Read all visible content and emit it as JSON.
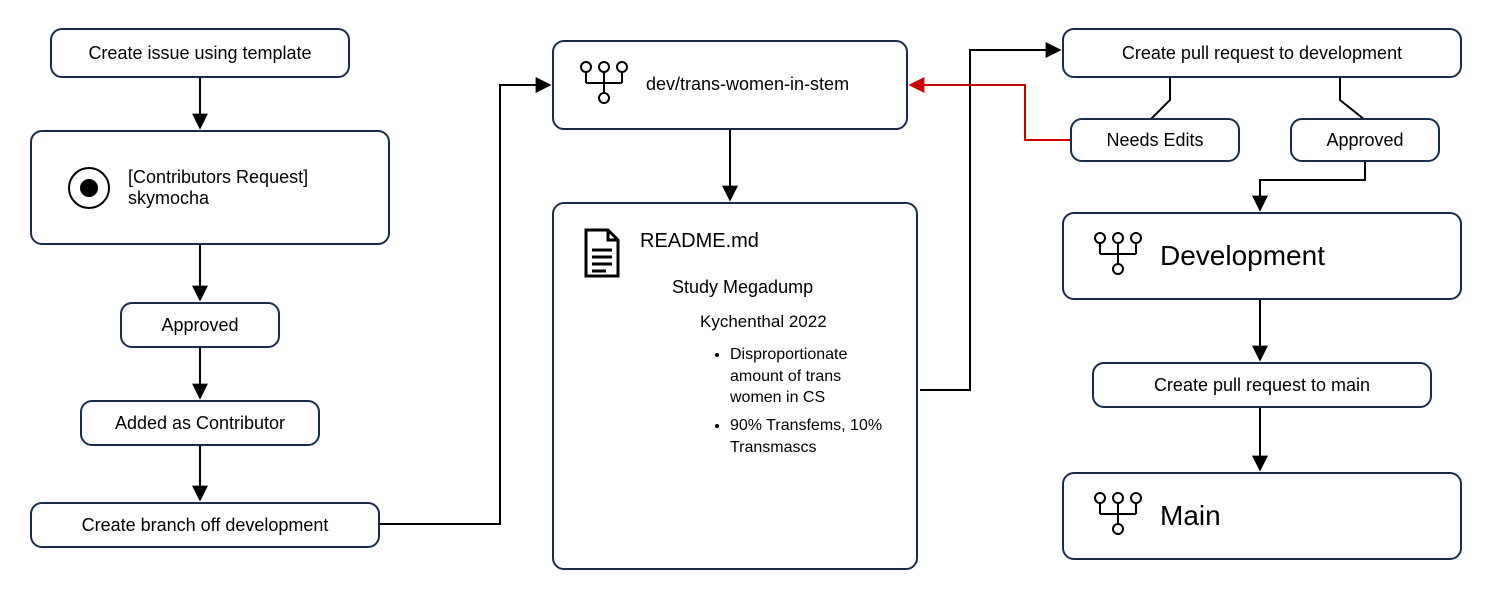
{
  "col1": {
    "create_issue": "Create issue using template",
    "contrib_request": "[Contributors Request] skymocha",
    "approved": "Approved",
    "added_contributor": "Added as Contributor",
    "create_branch": "Create branch off development"
  },
  "col2": {
    "branch_name": "dev/trans-women-in-stem",
    "readme_title": "README.md",
    "readme_h2": "Study Megadump",
    "readme_h3": "Kychenthal 2022",
    "readme_bullet1": "Disproportionate amount of trans women in CS",
    "readme_bullet2": "90% Transfems, 10% Transmascs"
  },
  "col3": {
    "pr_dev": "Create pull request to development",
    "needs_edits": "Needs Edits",
    "approved": "Approved",
    "development": "Development",
    "pr_main": "Create pull request to main",
    "main": "Main"
  }
}
